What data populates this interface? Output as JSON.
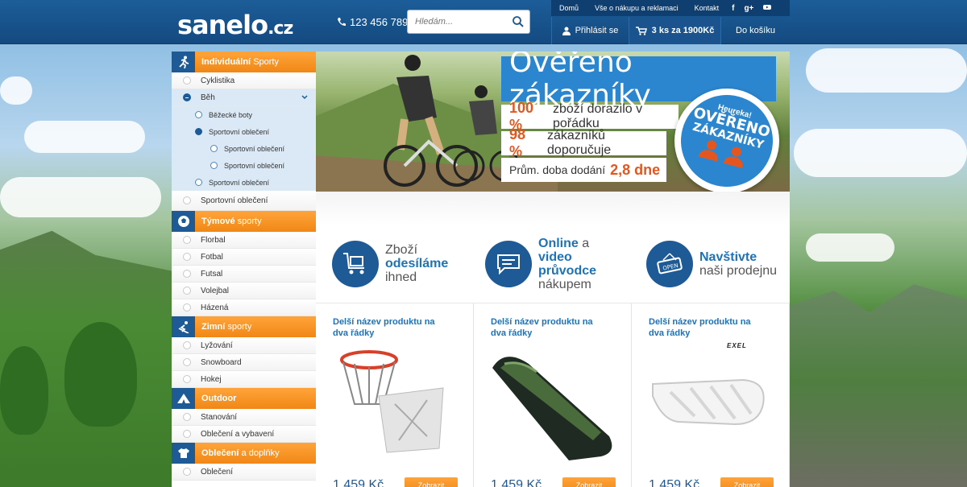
{
  "header": {
    "logo": "sanelo",
    "logo_tld": ".cz",
    "phone": "123 456 789",
    "search_placeholder": "Hledám...",
    "topnav": [
      "Domů",
      "Vše o nákupu a reklamaci",
      "Kontakt"
    ],
    "social": [
      "f",
      "g+",
      "yt"
    ],
    "login": "Přihlásit se",
    "cart_info": "3 ks za 1900Kč",
    "to_cart": "Do košíku"
  },
  "sidebar": {
    "categories": [
      {
        "head_bold": "Individuální",
        "head_thin": "Sporty",
        "icon": "running-icon"
      },
      {
        "head_bold": "Týmové",
        "head_thin": "sporty",
        "icon": "soccer-ball-icon"
      },
      {
        "head_bold": "Zimní",
        "head_thin": "sporty",
        "icon": "skier-icon"
      },
      {
        "head_bold": "Outdoor",
        "head_thin": "",
        "icon": "tent-icon"
      },
      {
        "head_bold": "Oblečení",
        "head_thin": "a doplňky",
        "icon": "tshirt-icon"
      }
    ],
    "individual": {
      "cyclistika": "Cyklistika",
      "beh": "Běh",
      "sub1": "Běžecké boty",
      "sub2": "Sportovní oblečení",
      "sub3": "Sportovní oblečení",
      "sub4": "Sportovní oblečení",
      "sub5": "Sportovní oblečení",
      "after": "Sportovní oblečení"
    },
    "team": [
      "Florbal",
      "Fotbal",
      "Futsal",
      "Volejbal",
      "Házená"
    ],
    "winter": [
      "Lyžování",
      "Snowboard",
      "Hokej"
    ],
    "outdoor": [
      "Stanování",
      "Oblečení a vybavení"
    ],
    "clothes": [
      "Oblečení"
    ]
  },
  "banner": {
    "title": "Ověřeno zákazníky",
    "row1_num": "100 %",
    "row1_text": "zboží dorazilo v pořádku",
    "row2_num": "98 %",
    "row2_text": "zákazníků doporučuje",
    "row3_text": "Prům. doba dodání",
    "row3_num": "2,8 dne",
    "badge_top": "Heureka!",
    "badge_mid": "OVĚŘENO",
    "badge_bot": "ZÁKAZNÍKY"
  },
  "features": [
    {
      "l1": "Zboží",
      "l2": "odesíláme",
      "l3": "ihned",
      "icon": "cart-package-icon"
    },
    {
      "l1": "Online",
      "l1b": " a",
      "l2": "video průvodce",
      "l3": "nákupem",
      "icon": "chat-bubble-icon"
    },
    {
      "l1": "Navštivte",
      "l2": "naši prodejnu",
      "icon": "open-sign-icon"
    }
  ],
  "products": [
    {
      "name": "Delší název produktu na dva řádky",
      "price": "1 459 Kč",
      "button": "Zobrazit"
    },
    {
      "name": "Delší název produktu na dva řádky",
      "price": "1 459 Kč",
      "button": "Zobrazit"
    },
    {
      "name": "Delší název produktu na dva řádky",
      "price": "1 459 Kč",
      "button": "Zobrazit",
      "brand": "EXEL"
    }
  ],
  "colors": {
    "brand_blue": "#1d5a96",
    "accent_orange": "#f08716",
    "link_blue": "#1d72b8"
  }
}
